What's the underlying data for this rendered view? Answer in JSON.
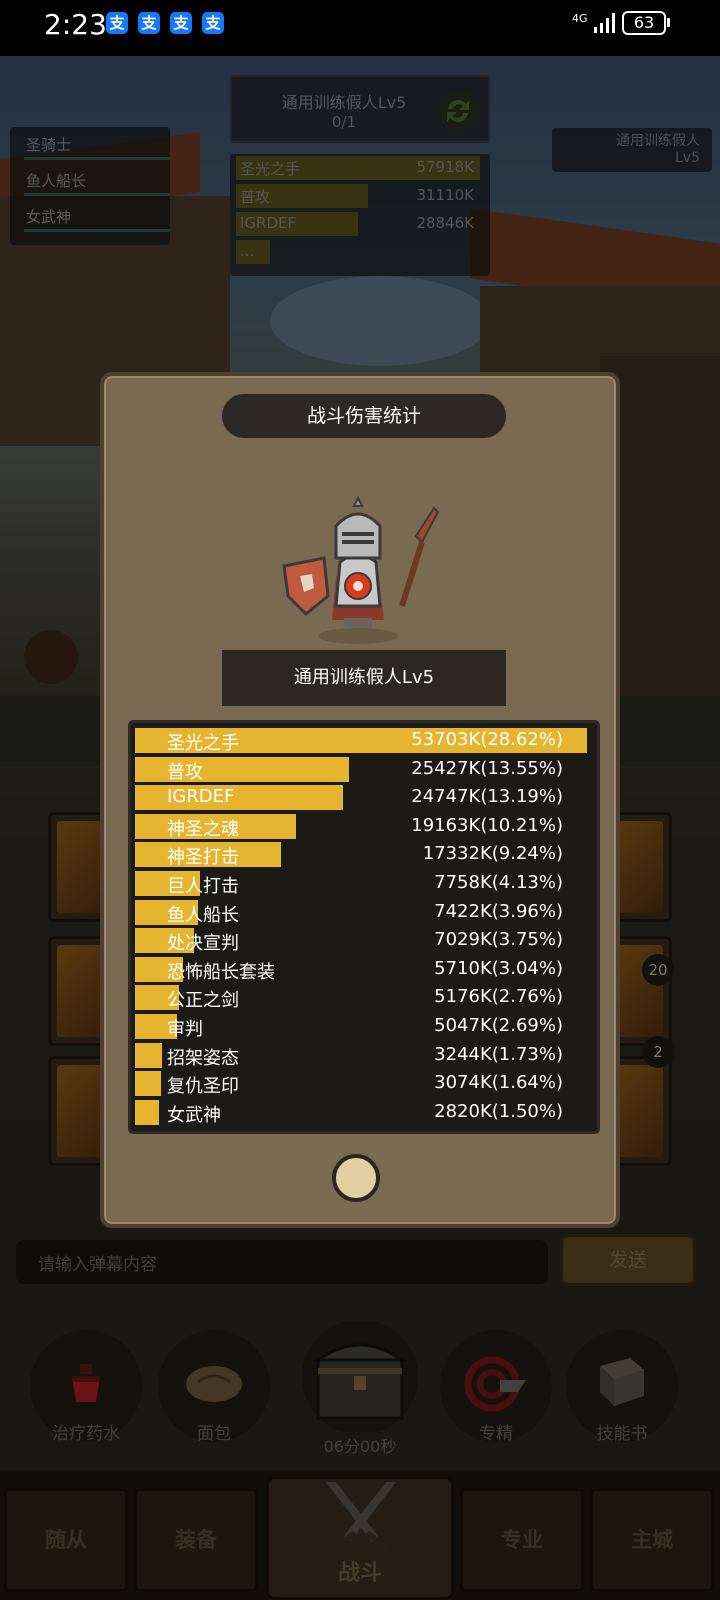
{
  "status_bar": {
    "time": "2:23",
    "pay_icons": [
      "支",
      "支",
      "支",
      "支"
    ],
    "network": "4G",
    "battery": "63"
  },
  "party": {
    "members": [
      "圣骑士",
      "鱼人船长",
      "女武神"
    ]
  },
  "target": {
    "name": "通用训练假人Lv5",
    "count": "0/1"
  },
  "right_target": {
    "name": "通用训练假人",
    "level": "Lv5"
  },
  "mini_damage": {
    "rows": [
      {
        "name": "圣光之手",
        "value": "57918K",
        "fraction": 1.0
      },
      {
        "name": "普攻",
        "value": "31110K",
        "fraction": 0.54
      },
      {
        "name": "IGRDEF",
        "value": "28846K",
        "fraction": 0.5
      },
      {
        "name": "...",
        "value": "",
        "fraction": 0.14
      }
    ]
  },
  "modal": {
    "title": "战斗伤害统计",
    "target_label": "通用训练假人Lv5",
    "rows": [
      {
        "name": "圣光之手",
        "value": "53703K(28.62%)",
        "percent": 28.62
      },
      {
        "name": "普攻",
        "value": "25427K(13.55%)",
        "percent": 13.55
      },
      {
        "name": "IGRDEF",
        "value": "24747K(13.19%)",
        "percent": 13.19
      },
      {
        "name": "神圣之魂",
        "value": "19163K(10.21%)",
        "percent": 10.21
      },
      {
        "name": "神圣打击",
        "value": "17332K(9.24%)",
        "percent": 9.24
      },
      {
        "name": "巨人打击",
        "value": "7758K(4.13%)",
        "percent": 4.13
      },
      {
        "name": "鱼人船长",
        "value": "7422K(3.96%)",
        "percent": 3.96
      },
      {
        "name": "处决宣判",
        "value": "7029K(3.75%)",
        "percent": 3.75
      },
      {
        "name": "恐怖船长套装",
        "value": "5710K(3.04%)",
        "percent": 3.04
      },
      {
        "name": "公正之剑",
        "value": "5176K(2.76%)",
        "percent": 2.76
      },
      {
        "name": "审判",
        "value": "5047K(2.69%)",
        "percent": 2.69
      },
      {
        "name": "招架姿态",
        "value": "3244K(1.73%)",
        "percent": 1.73
      },
      {
        "name": "复仇圣印",
        "value": "3074K(1.64%)",
        "percent": 1.64
      },
      {
        "name": "女武神",
        "value": "2820K(1.50%)",
        "percent": 1.5
      }
    ]
  },
  "chat": {
    "placeholder": "请输入弹幕内容",
    "send_label": "发送"
  },
  "items": {
    "potion": "治疗药水",
    "bread": "面包",
    "timer": "06分00秒",
    "specialize": "专精",
    "skillbook": "技能书"
  },
  "nav": {
    "followers": "随从",
    "equipment": "装备",
    "battle": "战斗",
    "profession": "专业",
    "main_city": "主城"
  },
  "slot_counts": {
    "top": "20",
    "bottom": "2"
  }
}
